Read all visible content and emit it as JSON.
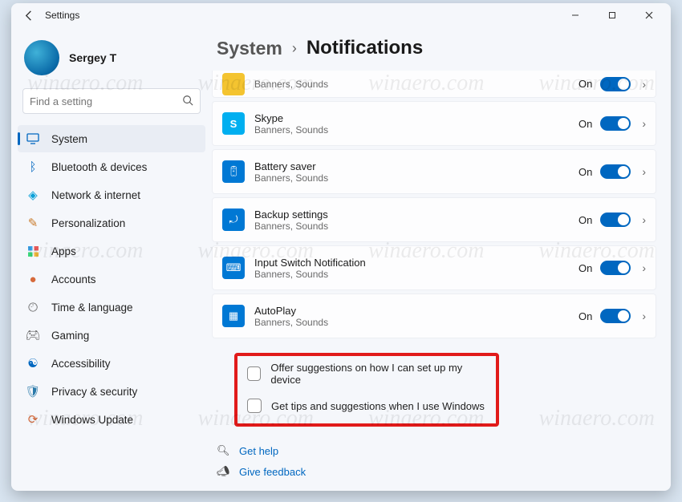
{
  "window": {
    "title": "Settings"
  },
  "user": {
    "name": "Sergey T"
  },
  "search": {
    "placeholder": "Find a setting"
  },
  "sidebar": {
    "items": [
      {
        "label": "System",
        "icon": "🖥️",
        "selected": true
      },
      {
        "label": "Bluetooth & devices",
        "icon": "ble"
      },
      {
        "label": "Network & internet",
        "icon": "🌐"
      },
      {
        "label": "Personalization",
        "icon": "🖌️"
      },
      {
        "label": "Apps",
        "icon": "grid"
      },
      {
        "label": "Accounts",
        "icon": "👤"
      },
      {
        "label": "Time & language",
        "icon": "🕘"
      },
      {
        "label": "Gaming",
        "icon": "🎮"
      },
      {
        "label": "Accessibility",
        "icon": "acc"
      },
      {
        "label": "Privacy & security",
        "icon": "🛡️"
      },
      {
        "label": "Windows Update",
        "icon": "🔄"
      }
    ]
  },
  "breadcrumb": {
    "parent": "System",
    "page": "Notifications"
  },
  "apps": [
    {
      "title": "",
      "sub": "Banners, Sounds",
      "state": "On",
      "icon_bg": "#f4c430",
      "partial": true
    },
    {
      "title": "Skype",
      "sub": "Banners, Sounds",
      "state": "On",
      "icon_bg": "#00aff0"
    },
    {
      "title": "Battery saver",
      "sub": "Banners, Sounds",
      "state": "On",
      "icon_bg": "#0078d4"
    },
    {
      "title": "Backup settings",
      "sub": "Banners, Sounds",
      "state": "On",
      "icon_bg": "#0078d4"
    },
    {
      "title": "Input Switch Notification",
      "sub": "Banners, Sounds",
      "state": "On",
      "icon_bg": "#0078d4"
    },
    {
      "title": "AutoPlay",
      "sub": "Banners, Sounds",
      "state": "On",
      "icon_bg": "#0078d4"
    }
  ],
  "checkboxes": [
    {
      "label": "Offer suggestions on how I can set up my device",
      "checked": false
    },
    {
      "label": "Get tips and suggestions when I use Windows",
      "checked": false
    }
  ],
  "footer": {
    "help": "Get help",
    "feedback": "Give feedback"
  },
  "watermark": "winaero.com"
}
